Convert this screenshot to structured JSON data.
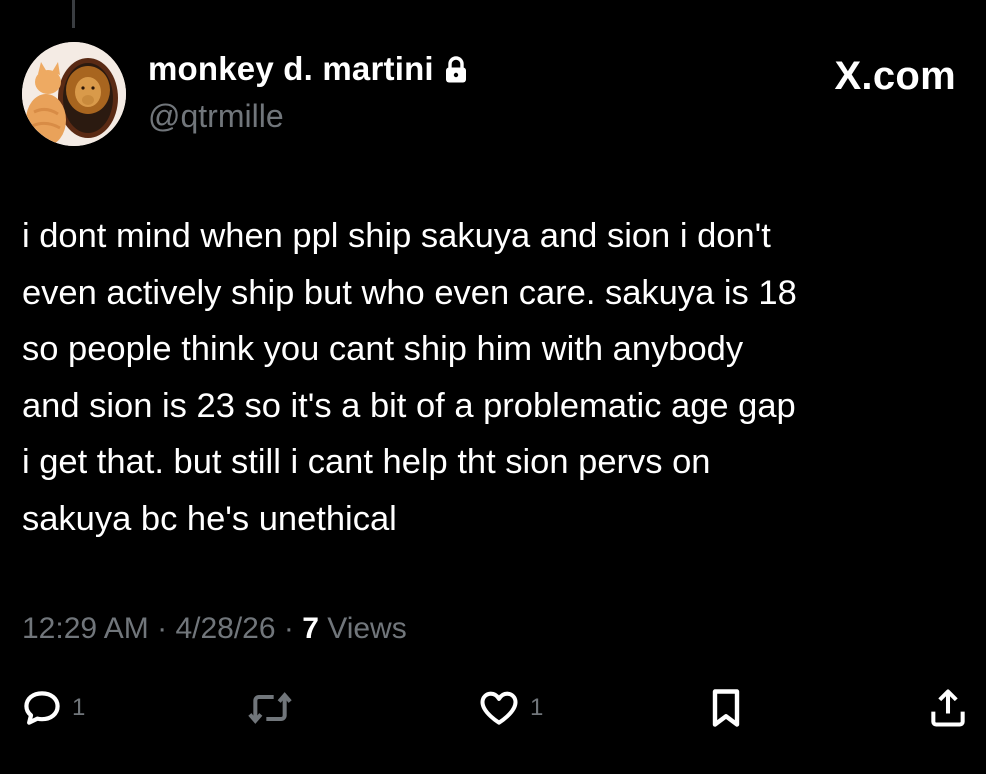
{
  "tweet": {
    "author": {
      "display_name": "monkey d. martini",
      "handle": "@qtrmille",
      "protected_icon": "lock-icon",
      "avatar": "avatar-cat-and-lion"
    },
    "brand": "X.com",
    "text": "i dont mind when ppl ship sakuya and sion i don't\neven actively ship but who even care. sakuya is 18\nso people think you cant ship him with anybody\nand sion is 23 so it's a bit of a problematic age gap\ni get that. but still i cant help tht sion pervs on\nsakuya bc he's unethical",
    "meta": {
      "time": "12:29 AM",
      "separator": " · ",
      "date": "4/28/26",
      "views_count": "7",
      "views_label": " Views"
    },
    "actions": {
      "reply": {
        "icon": "reply-icon",
        "count": "1"
      },
      "repost": {
        "icon": "repost-icon",
        "count": ""
      },
      "like": {
        "icon": "heart-icon",
        "count": "1"
      },
      "bookmark": {
        "icon": "bookmark-icon"
      },
      "share": {
        "icon": "share-icon"
      }
    }
  },
  "colors": {
    "background": "#000000",
    "primary_text": "#ffffff",
    "secondary_text": "#71767b",
    "thread_line": "#3a3d41"
  }
}
